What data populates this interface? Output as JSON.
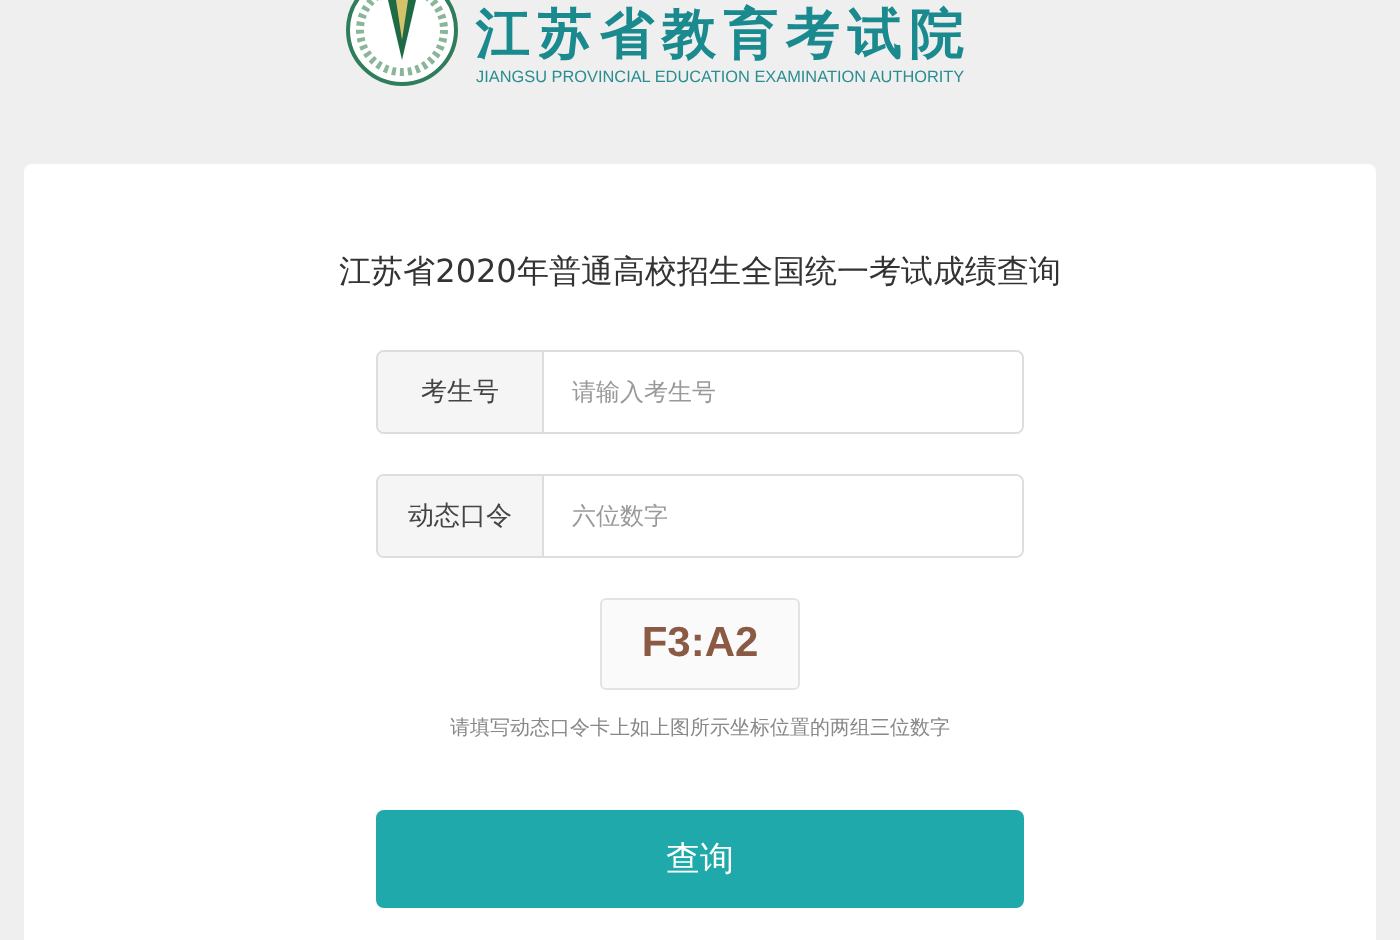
{
  "header": {
    "title": "江苏省教育考试院",
    "subtitle": "JIANGSU PROVINCIAL EDUCATION EXAMINATION AUTHORITY"
  },
  "form": {
    "title": "江苏省2020年普通高校招生全国统一考试成绩查询",
    "fields": [
      {
        "label": "考生号",
        "placeholder": "请输入考生号"
      },
      {
        "label": "动态口令",
        "placeholder": "六位数字"
      }
    ],
    "code": "F3:A2",
    "hint": "请填写动态口令卡上如上图所示坐标位置的两组三位数字",
    "button": "查询"
  }
}
